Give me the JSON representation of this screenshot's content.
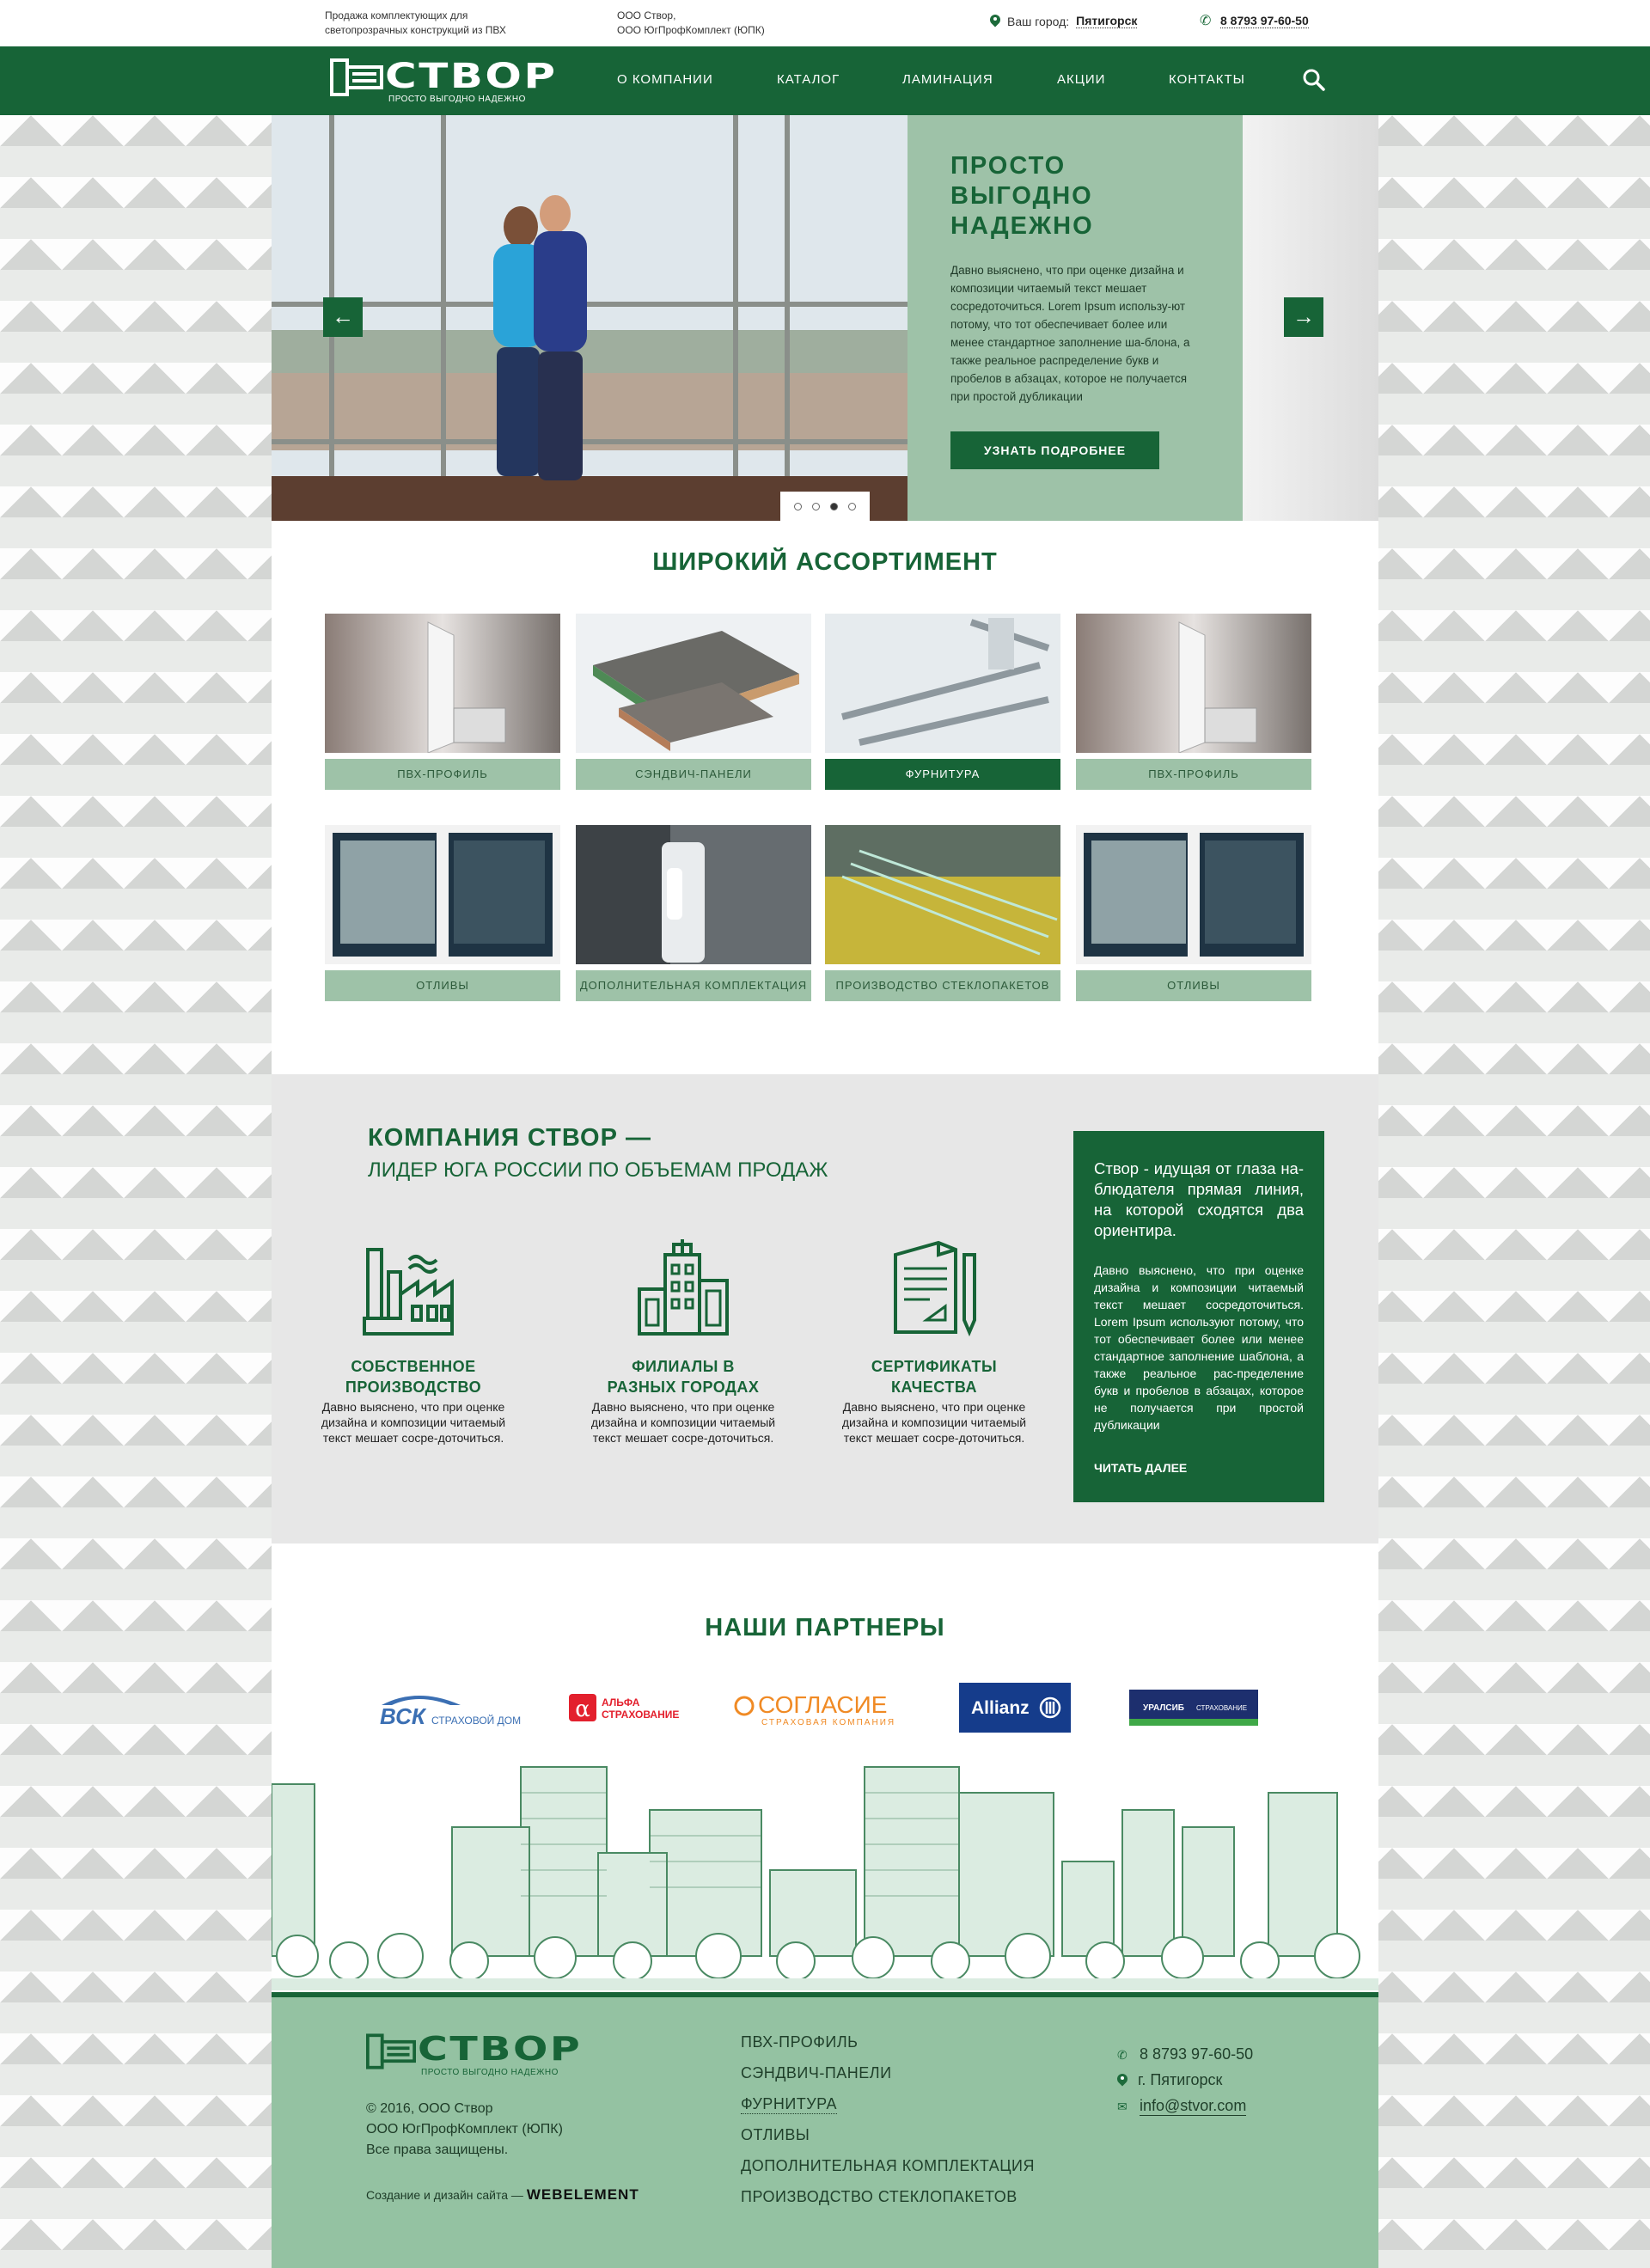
{
  "topbar": {
    "tagline_1": "Продажа комплектующих для",
    "tagline_2": "светопрозрачных конструкций из ПВХ",
    "company_1": "ООО Створ,",
    "company_2": "ООО ЮгПрофКомплект (ЮПК)",
    "city_label": "Ваш город:",
    "city_value": "Пятигорск",
    "phone": "8 8793  97-60-50"
  },
  "nav": {
    "logo_word": "СТВОР",
    "logo_slogan": "ПРОСТО ВЫГОДНО НАДЕЖНО",
    "items": [
      "О КОМПАНИИ",
      "КАТАЛОГ",
      "ЛАМИНАЦИЯ",
      "АКЦИИ",
      "КОНТАКТЫ"
    ]
  },
  "hero": {
    "title_1": "ПРОСТО",
    "title_2": "ВЫГОДНО",
    "title_3": "НАДЕЖНО",
    "text": "Давно выяснено, что при оценке дизайна и композиции читаемый текст мешает сосредоточиться. Lorem Ipsum использу-ют потому, что тот обеспечивает более или менее стандартное заполнение ша-блона, а также реальное распределение букв и пробелов в абзацах, которое не получается при простой дубликации",
    "button": "УЗНАТЬ ПОДРОБНЕЕ",
    "prev": "←",
    "next": "→",
    "slides": 4,
    "active_slide": 3
  },
  "assortment": {
    "title": "ШИРОКИЙ АССОРТИМЕНТ",
    "items": [
      {
        "label": "ПВХ-ПРОФИЛЬ"
      },
      {
        "label": "СЭНДВИЧ-ПАНЕЛИ"
      },
      {
        "label": "ФУРНИТУРА"
      },
      {
        "label": "ПВХ-ПРОФИЛЬ"
      },
      {
        "label": "ОТЛИВЫ"
      },
      {
        "label": "ДОПОЛНИТЕЛЬНАЯ КОМПЛЕКТАЦИЯ"
      },
      {
        "label": "ПРОИЗВОДСТВО СТЕКЛОПАКЕТОВ"
      },
      {
        "label": "ОТЛИВЫ"
      }
    ]
  },
  "company": {
    "title": "КОМПАНИЯ СТВОР —",
    "subtitle": "ЛИДЕР ЮГА РОССИИ ПО ОБЪЕМАМ ПРОДАЖ",
    "features": [
      {
        "title_1": "СОБСТВЕННОЕ",
        "title_2": "ПРОИЗВОДСТВО",
        "text": "Давно выяснено, что при оценке дизайна и композиции читаемый текст мешает сосре-доточиться.",
        "icon": "factory-icon"
      },
      {
        "title_1": "ФИЛИАЛЫ В",
        "title_2": "РАЗНЫХ ГОРОДАХ",
        "text": "Давно выяснено, что при оценке дизайна и композиции читаемый текст мешает сосре-доточиться.",
        "icon": "buildings-icon"
      },
      {
        "title_1": "СЕРТИФИКАТЫ",
        "title_2": "КАЧЕСТВА",
        "text": "Давно выяснено, что при оценке дизайна и композиции читаемый текст мешает сосре-доточиться.",
        "icon": "certificate-icon"
      }
    ],
    "box_quote": "Створ - идущая от глаза на-блюдателя прямая линия, на которой сходятся два ориентира.",
    "box_text": "Давно выяснено, что при оценке дизайна и композиции читаемый текст мешает сосредоточиться. Lorem Ipsum используют потому, что тот обеспечивает более или менее стандартное заполнение шаблона, а также реальное рас-пределение букв и пробелов в абзацах, которое не получается при простой дубликации",
    "box_link": "ЧИТАТЬ ДАЛЕЕ"
  },
  "partners": {
    "title": "НАШИ ПАРТНЕРЫ",
    "vsk_1": "ВСК",
    "vsk_2": "СТРАХОВОЙ ДОМ",
    "alfa_sym": "α",
    "alfa_1": "АЛЬФА",
    "alfa_2": "СТРАХОВАНИЕ",
    "soglasie_1": "СОГЛАСИЕ",
    "soglasie_2": "СТРАХОВАЯ КОМПАНИЯ",
    "allianz": "Allianz",
    "uralsib_1": "УРАЛСИБ",
    "uralsib_2": "СТРАХОВАНИЕ"
  },
  "footer": {
    "logo_word": "СТВОР",
    "logo_slogan": "ПРОСТО ВЫГОДНО НАДЕЖНО",
    "copy_1": "© 2016,  ООО Створ",
    "copy_2": "ООО ЮгПрофКомплект (ЮПК)",
    "copy_3": "Все права защищены.",
    "dev_label": "Создание и дизайн сайта —",
    "dev_name": "WEBELEMENT",
    "links": [
      "ПВХ-ПРОФИЛЬ",
      "СЭНДВИЧ-ПАНЕЛИ",
      "ФУРНИТУРА",
      "ОТЛИВЫ",
      "ДОПОЛНИТЕЛЬНАЯ КОМПЛЕКТАЦИЯ",
      "ПРОИЗВОДСТВО СТЕКЛОПАКЕТОВ"
    ],
    "phone": "8 8793  97-60-50",
    "city": "г. Пятигорск",
    "email": "info@stvor.com"
  },
  "colors": {
    "brand_green": "#176437",
    "light_green": "#9ec2a8",
    "footer_green": "#94c2a2"
  }
}
